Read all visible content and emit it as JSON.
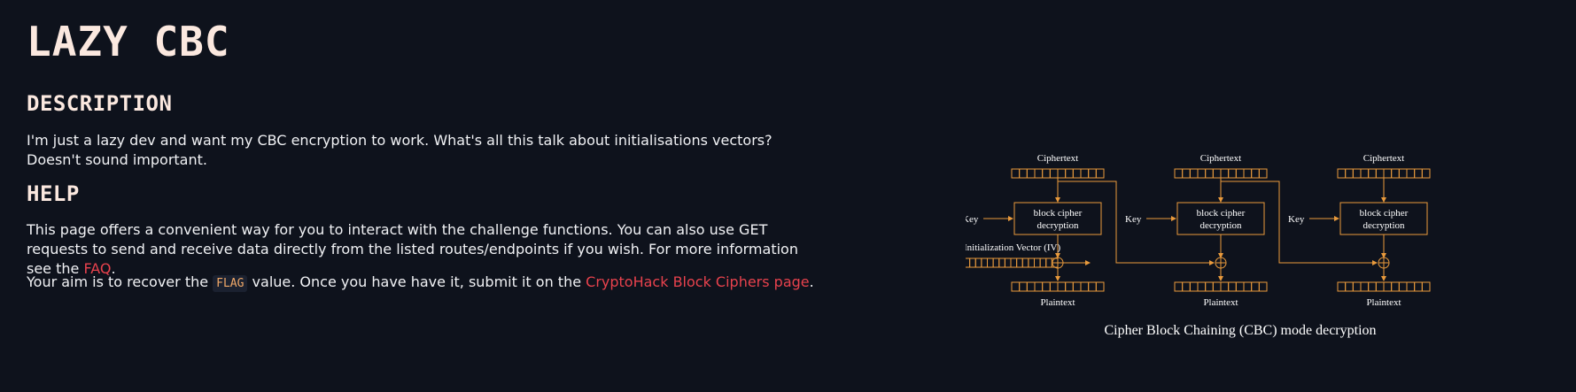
{
  "page": {
    "title": "LAZY CBC"
  },
  "description": {
    "heading": "DESCRIPTION",
    "text": "I'm just a lazy dev and want my CBC encryption to work. What's all this talk about initialisations vectors? Doesn't sound important."
  },
  "help": {
    "heading": "HELP",
    "text_before_link": "This page offers a convenient way for you to interact with the challenge functions. You can also use GET requests to send and receive data directly from the listed routes/endpoints if you wish. For more information see the ",
    "faq_link": "FAQ",
    "text_after_link": ".",
    "aim_before_code": "Your aim is to recover the ",
    "aim_code": "FLAG",
    "aim_mid": " value. Once you have have it, submit it on the ",
    "aim_link": "CryptoHack Block Ciphers page",
    "aim_end": "."
  },
  "diagram": {
    "ciphertext_label": "Ciphertext",
    "plaintext_label": "Plaintext",
    "key_label": "Key",
    "block_label_line1": "block cipher",
    "block_label_line2": "decryption",
    "iv_label": "Initialization Vector (IV)",
    "caption": "Cipher Block Chaining (CBC) mode decryption",
    "color": "#e99a3c"
  }
}
